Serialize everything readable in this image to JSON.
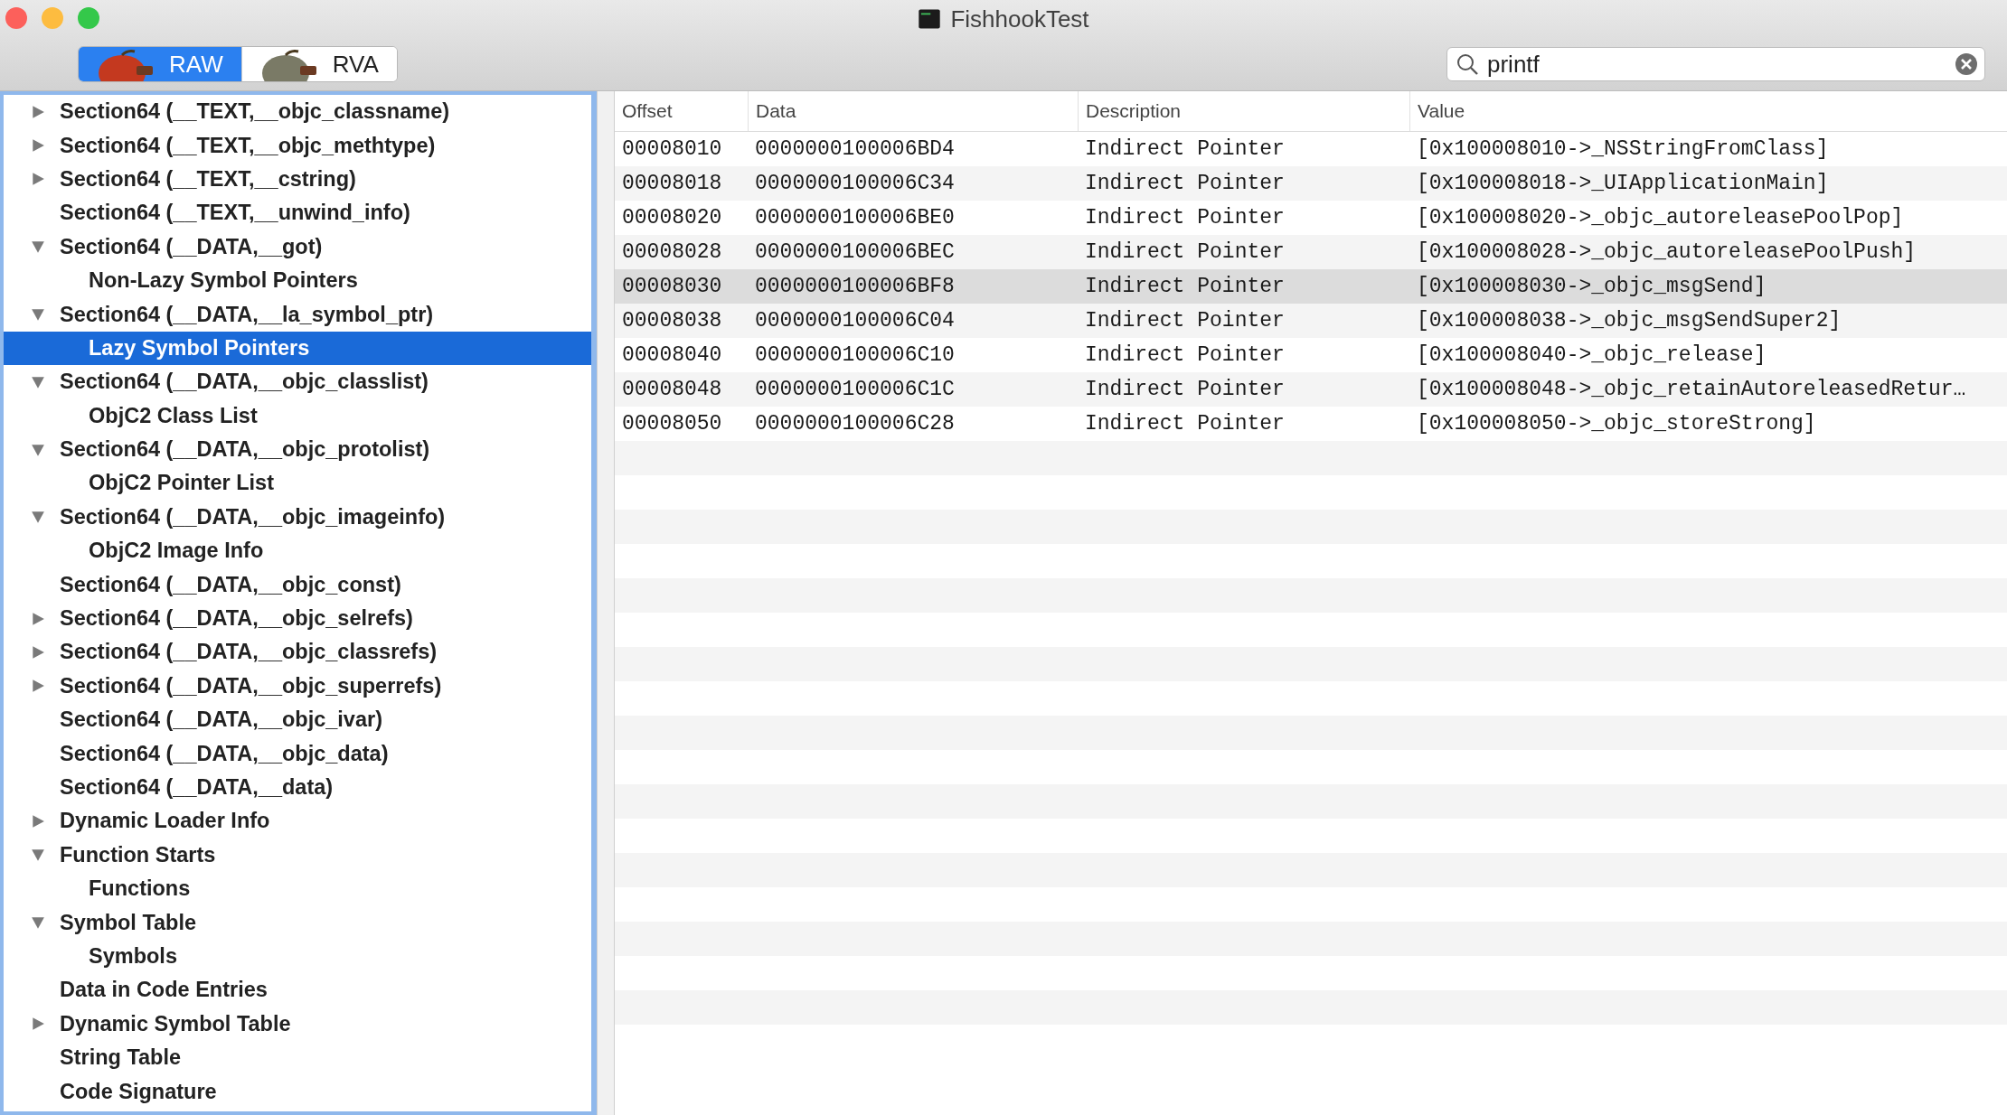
{
  "window": {
    "title": "FishhookTest"
  },
  "mode_switch": [
    {
      "label": "RAW",
      "selected": true
    },
    {
      "label": "RVA",
      "selected": false
    }
  ],
  "search": {
    "value": "printf"
  },
  "tree": [
    {
      "label": "Section64 (__TEXT,__objc_classname)",
      "expanded": false,
      "selected": false
    },
    {
      "label": "Section64 (__TEXT,__objc_methtype)",
      "expanded": false,
      "selected": false
    },
    {
      "label": "Section64 (__TEXT,__cstring)",
      "expanded": false,
      "selected": false
    },
    {
      "label": "Section64 (__TEXT,__unwind_info)",
      "selected": false
    },
    {
      "label": "Section64 (__DATA,__got)",
      "expanded": true,
      "selected": false,
      "children": [
        {
          "label": "Non-Lazy Symbol Pointers",
          "selected": false
        }
      ]
    },
    {
      "label": "Section64 (__DATA,__la_symbol_ptr)",
      "expanded": true,
      "selected": false,
      "children": [
        {
          "label": "Lazy Symbol Pointers",
          "selected": true
        }
      ]
    },
    {
      "label": "Section64 (__DATA,__objc_classlist)",
      "expanded": true,
      "selected": false,
      "children": [
        {
          "label": "ObjC2 Class List",
          "selected": false
        }
      ]
    },
    {
      "label": "Section64 (__DATA,__objc_protolist)",
      "expanded": true,
      "selected": false,
      "children": [
        {
          "label": "ObjC2 Pointer List",
          "selected": false
        }
      ]
    },
    {
      "label": "Section64 (__DATA,__objc_imageinfo)",
      "expanded": true,
      "selected": false,
      "children": [
        {
          "label": "ObjC2 Image Info",
          "selected": false
        }
      ]
    },
    {
      "label": "Section64 (__DATA,__objc_const)",
      "selected": false
    },
    {
      "label": "Section64 (__DATA,__objc_selrefs)",
      "expanded": false,
      "selected": false
    },
    {
      "label": "Section64 (__DATA,__objc_classrefs)",
      "expanded": false,
      "selected": false
    },
    {
      "label": "Section64 (__DATA,__objc_superrefs)",
      "expanded": false,
      "selected": false
    },
    {
      "label": "Section64 (__DATA,__objc_ivar)",
      "selected": false
    },
    {
      "label": "Section64 (__DATA,__objc_data)",
      "selected": false
    },
    {
      "label": "Section64 (__DATA,__data)",
      "selected": false
    },
    {
      "label": "Dynamic Loader Info",
      "expanded": false,
      "selected": false
    },
    {
      "label": "Function Starts",
      "expanded": true,
      "selected": false,
      "children": [
        {
          "label": "Functions",
          "selected": false
        }
      ]
    },
    {
      "label": "Symbol Table",
      "expanded": true,
      "selected": false,
      "children": [
        {
          "label": "Symbols",
          "selected": false
        }
      ]
    },
    {
      "label": "Data in Code Entries",
      "selected": false
    },
    {
      "label": "Dynamic Symbol Table",
      "expanded": false,
      "selected": false
    },
    {
      "label": "String Table",
      "selected": false
    },
    {
      "label": "Code Signature",
      "selected": false
    }
  ],
  "table": {
    "columns": [
      "Offset",
      "Data",
      "Description",
      "Value"
    ],
    "rows": [
      {
        "cells": [
          "00008010",
          "0000000100006BD4",
          "Indirect Pointer",
          "[0x100008010->_NSStringFromClass]"
        ],
        "selected": false
      },
      {
        "cells": [
          "00008018",
          "0000000100006C34",
          "Indirect Pointer",
          "[0x100008018->_UIApplicationMain]"
        ],
        "selected": false
      },
      {
        "cells": [
          "00008020",
          "0000000100006BE0",
          "Indirect Pointer",
          "[0x100008020->_objc_autoreleasePoolPop]"
        ],
        "selected": false
      },
      {
        "cells": [
          "00008028",
          "0000000100006BEC",
          "Indirect Pointer",
          "[0x100008028->_objc_autoreleasePoolPush]"
        ],
        "selected": false
      },
      {
        "cells": [
          "00008030",
          "0000000100006BF8",
          "Indirect Pointer",
          "[0x100008030->_objc_msgSend]"
        ],
        "selected": true
      },
      {
        "cells": [
          "00008038",
          "0000000100006C04",
          "Indirect Pointer",
          "[0x100008038->_objc_msgSendSuper2]"
        ],
        "selected": false
      },
      {
        "cells": [
          "00008040",
          "0000000100006C10",
          "Indirect Pointer",
          "[0x100008040->_objc_release]"
        ],
        "selected": false
      },
      {
        "cells": [
          "00008048",
          "0000000100006C1C",
          "Indirect Pointer",
          "[0x100008048->_objc_retainAutoreleasedRetur…"
        ],
        "selected": false
      },
      {
        "cells": [
          "00008050",
          "0000000100006C28",
          "Indirect Pointer",
          "[0x100008050->_objc_storeStrong]"
        ],
        "selected": false
      }
    ]
  }
}
